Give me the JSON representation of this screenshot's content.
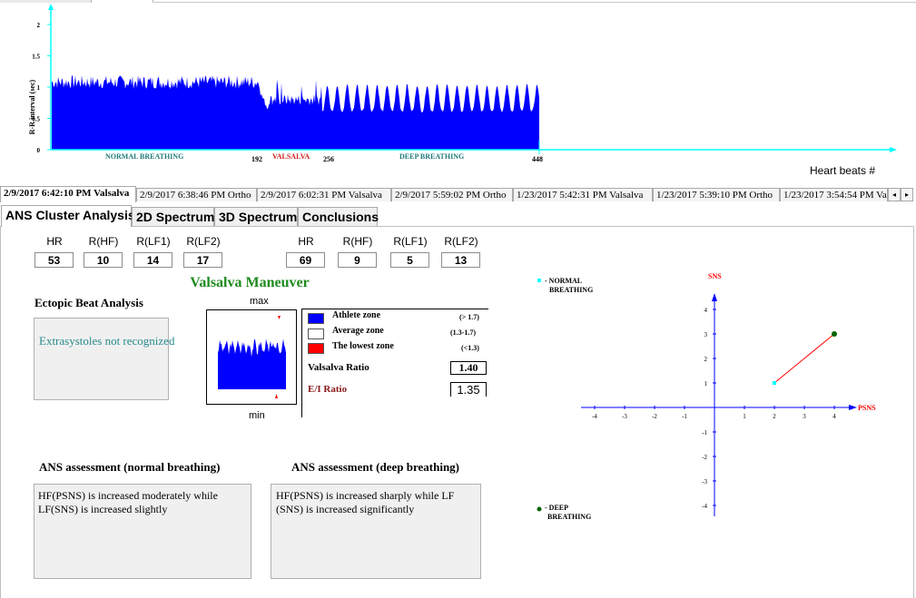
{
  "rr_chart": {
    "y_axis_label": "R-R interval (sec)",
    "y_ticks": [
      "0",
      "0.5",
      "1",
      "1.5",
      "2"
    ],
    "x_axis_label": "Heart beats #",
    "x_markers": [
      "192",
      "256",
      "448"
    ],
    "segment_labels": [
      "NORMAL BREATHING",
      "VALSALVA",
      "DEEP BREATHING"
    ],
    "colors": {
      "bars": "#0000ff",
      "axis": "#00ffff",
      "normal_label": "#227a7a",
      "valsalva_label": "#d02020"
    }
  },
  "session_tabs": [
    "2/9/2017 6:42:10 PM Valsalva",
    "2/9/2017 6:38:46 PM Ortho",
    "2/9/2017 6:02:31 PM Valsalva",
    "2/9/2017 5:59:02 PM Ortho",
    "1/23/2017 5:42:31 PM Valsalva",
    "1/23/2017 5:39:10 PM Ortho",
    "1/23/2017 3:54:54 PM Va"
  ],
  "session_nav": {
    "prev_icon": "◂",
    "next_icon": "▸"
  },
  "main_tabs": [
    "ANS Cluster Analysis",
    "2D Spectrum",
    "3D Spectrum",
    "Conclusions"
  ],
  "metrics_left": {
    "headers": [
      "HR",
      "R(HF)",
      "R(LF1)",
      "R(LF2)"
    ],
    "values": [
      "53",
      "10",
      "14",
      "17"
    ]
  },
  "metrics_right": {
    "headers": [
      "HR",
      "R(HF)",
      "R(LF1)",
      "R(LF2)"
    ],
    "values": [
      "69",
      "9",
      "5",
      "13"
    ]
  },
  "maneuver_title": "Valsalva Maneuver",
  "ectopic": {
    "title": "Ectopic Beat Analysis",
    "message": "Extrasystoles not recognized"
  },
  "mini_chart": {
    "max_label": "max",
    "min_label": "min"
  },
  "zones": [
    {
      "name": "Athlete zone",
      "range": "(> 1.7)",
      "color": "#0000ff"
    },
    {
      "name": "Average zone",
      "range": "(1.3-1.7)",
      "color": "#ffffff"
    },
    {
      "name": "The lowest zone",
      "range": "(<1.3)",
      "color": "#ff0000"
    }
  ],
  "valsalva_ratio": {
    "label": "Valsalva Ratio",
    "value": "1.40"
  },
  "ei_ratio": {
    "label": "E/I Ratio",
    "value": "1.35",
    "color": "#8b1a1a"
  },
  "assessment_normal": {
    "title": "ANS assessment (normal breathing)",
    "text": "HF(PSNS) is increased moderately while LF(SNS) is increased slightly"
  },
  "assessment_deep": {
    "title": "ANS assessment (deep breathing)",
    "text": "HF(PSNS) is increased sharply while LF (SNS) is increased significantly"
  },
  "scatter": {
    "x_axis_label": "PSNS",
    "y_axis_label": "SNS",
    "x_ticks": [
      "-4",
      "-3",
      "-2",
      "-1",
      "1",
      "2",
      "3",
      "4"
    ],
    "y_ticks": [
      "4",
      "3",
      "2",
      "1",
      "-1",
      "-2",
      "-3",
      "-4"
    ],
    "legend_normal": "- NORMAL BREATHING",
    "legend_deep": "- DEEP BREATHING",
    "colors": {
      "axis": "#0000ff",
      "label": "#ff0000",
      "normal_point": "#00ffff",
      "deep_point": "#006400",
      "line": "#ff0000"
    }
  },
  "chart_data": {
    "type": "scatter",
    "xlabel": "PSNS",
    "ylabel": "SNS",
    "xlim": [
      -4,
      4
    ],
    "ylim": [
      -4,
      4
    ],
    "series": [
      {
        "name": "NORMAL BREATHING",
        "x": [
          2
        ],
        "y": [
          1
        ]
      },
      {
        "name": "DEEP BREATHING",
        "x": [
          4
        ],
        "y": [
          3
        ]
      }
    ]
  }
}
